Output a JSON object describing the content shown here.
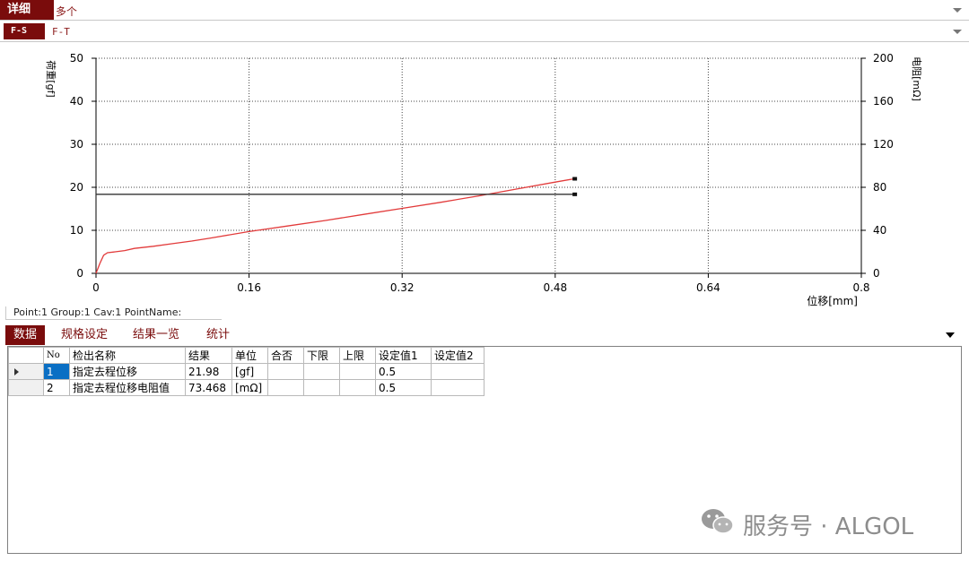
{
  "header": {
    "detail_tab": "详细",
    "detail_value": "多个",
    "mode_tab": "F-S",
    "mode_value": "F-T"
  },
  "chart_data": {
    "type": "line",
    "xlabel": "位移[mm]",
    "ylabel": "荷重[gf]",
    "y2label": "电阻[mΩ]",
    "xlim": [
      0,
      0.8
    ],
    "ylim": [
      0,
      50
    ],
    "y2lim": [
      0,
      200
    ],
    "xticks": [
      "0",
      "0.16",
      "0.32",
      "0.48",
      "0.64",
      "0.8"
    ],
    "yticks": [
      "0",
      "10",
      "20",
      "30",
      "40",
      "50"
    ],
    "y2ticks": [
      "0",
      "40",
      "80",
      "120",
      "160",
      "200"
    ],
    "grid": true,
    "series": [
      {
        "axis": "left",
        "color": "#e23b3b",
        "x": [
          0,
          0.004,
          0.008,
          0.012,
          0.02,
          0.03,
          0.04,
          0.06,
          0.08,
          0.1,
          0.12,
          0.16,
          0.2,
          0.24,
          0.28,
          0.32,
          0.36,
          0.4,
          0.44,
          0.48,
          0.5
        ],
        "y": [
          0,
          2.3,
          4.2,
          4.8,
          5.0,
          5.3,
          5.8,
          6.3,
          6.9,
          7.5,
          8.2,
          9.7,
          11.0,
          12.3,
          13.7,
          15.1,
          16.5,
          18.0,
          19.6,
          21.2,
          21.98
        ]
      },
      {
        "axis": "right",
        "color": "#333333",
        "x": [
          0,
          0.5
        ],
        "y": [
          73.468,
          73.468
        ]
      }
    ]
  },
  "status": "Point:1  Group:1  Cav:1  PointName:",
  "tabs": [
    "数据",
    "规格设定",
    "结果一览",
    "统计"
  ],
  "table": {
    "headers": [
      "No",
      "检出名称",
      "结果",
      "单位",
      "合否",
      "下限",
      "上限",
      "设定值1",
      "设定值2"
    ],
    "rows": [
      [
        "1",
        "指定去程位移",
        "21.98",
        "[gf]",
        "",
        "",
        "",
        "0.5",
        ""
      ],
      [
        "2",
        "指定去程位移电阻值",
        "73.468",
        "[mΩ]",
        "",
        "",
        "",
        "0.5",
        ""
      ]
    ]
  },
  "watermark": "服务号 · ALGOL"
}
